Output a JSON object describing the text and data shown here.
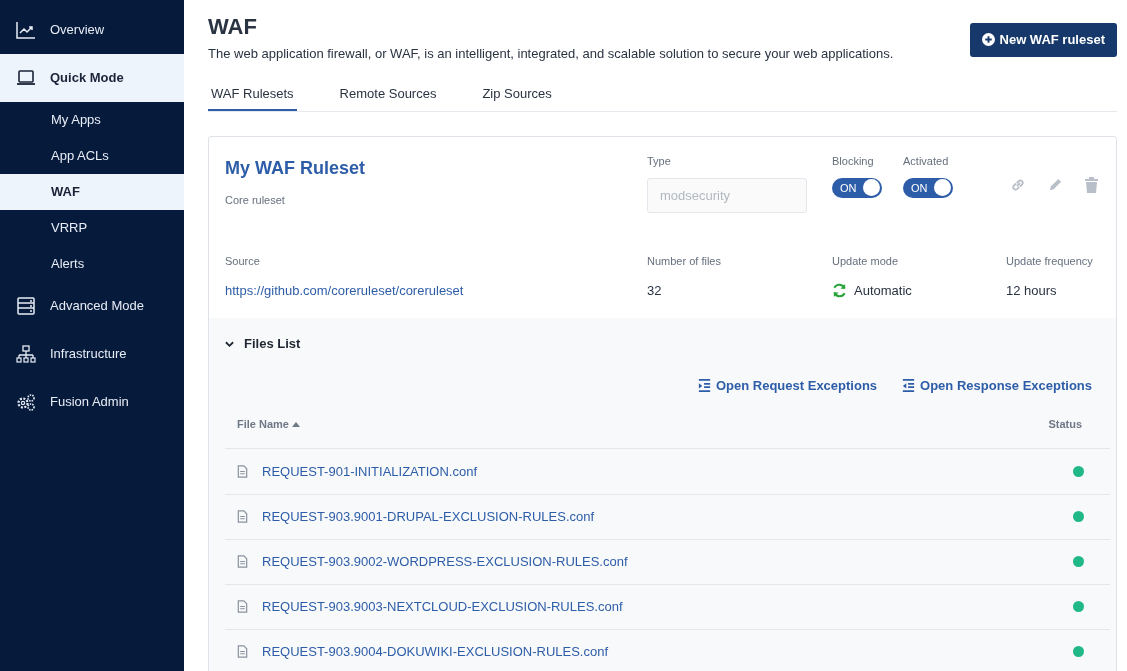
{
  "sidebar": {
    "items": [
      {
        "label": "Overview",
        "kind": "chart",
        "selected": false
      },
      {
        "label": "Quick Mode",
        "kind": "laptop",
        "selected": true,
        "children": [
          {
            "label": "My Apps",
            "selected": false
          },
          {
            "label": "App ACLs",
            "selected": false
          },
          {
            "label": "WAF",
            "selected": true
          },
          {
            "label": "VRRP",
            "selected": false
          },
          {
            "label": "Alerts",
            "selected": false
          }
        ]
      },
      {
        "label": "Advanced Mode",
        "kind": "server",
        "selected": false
      },
      {
        "label": "Infrastructure",
        "kind": "network",
        "selected": false
      },
      {
        "label": "Fusion Admin",
        "kind": "gears",
        "selected": false
      }
    ]
  },
  "page": {
    "title": "WAF",
    "description": "The web application firewall, or WAF, is an intelligent, integrated, and scalable solution to secure your web applications.",
    "new_button": "New WAF ruleset"
  },
  "tabs": [
    {
      "label": "WAF Rulesets",
      "selected": true
    },
    {
      "label": "Remote Sources",
      "selected": false
    },
    {
      "label": "Zip Sources",
      "selected": false
    }
  ],
  "ruleset": {
    "name": "My WAF Ruleset",
    "subtitle": "Core ruleset",
    "type_label": "Type",
    "type_placeholder": "modsecurity",
    "toggles": [
      {
        "label": "Blocking",
        "text": "ON",
        "on": true
      },
      {
        "label": "Activated",
        "text": "ON",
        "on": true
      }
    ],
    "source_label": "Source",
    "source": "https://github.com/coreruleset/coreruleset",
    "files_label": "Number of files",
    "files": "32",
    "mode_label": "Update mode",
    "mode": "Automatic",
    "freq_label": "Update frequency",
    "freq": "12 hours"
  },
  "files_list": {
    "title": "Files List",
    "expanded": true,
    "actions": [
      {
        "label": "Open Request Exceptions",
        "kind": "request"
      },
      {
        "label": "Open Response Exceptions",
        "kind": "response"
      }
    ],
    "columns": [
      "File Name",
      "Status"
    ],
    "rows": [
      {
        "name": "REQUEST-901-INITIALIZATION.conf",
        "color": "#20b886"
      },
      {
        "name": "REQUEST-903.9001-DRUPAL-EXCLUSION-RULES.conf",
        "color": "#20b886"
      },
      {
        "name": "REQUEST-903.9002-WORDPRESS-EXCLUSION-RULES.conf",
        "color": "#20b886"
      },
      {
        "name": "REQUEST-903.9003-NEXTCLOUD-EXCLUSION-RULES.conf",
        "color": "#20b886"
      },
      {
        "name": "REQUEST-903.9004-DOKUWIKI-EXCLUSION-RULES.conf",
        "color": "#20b886"
      }
    ]
  }
}
